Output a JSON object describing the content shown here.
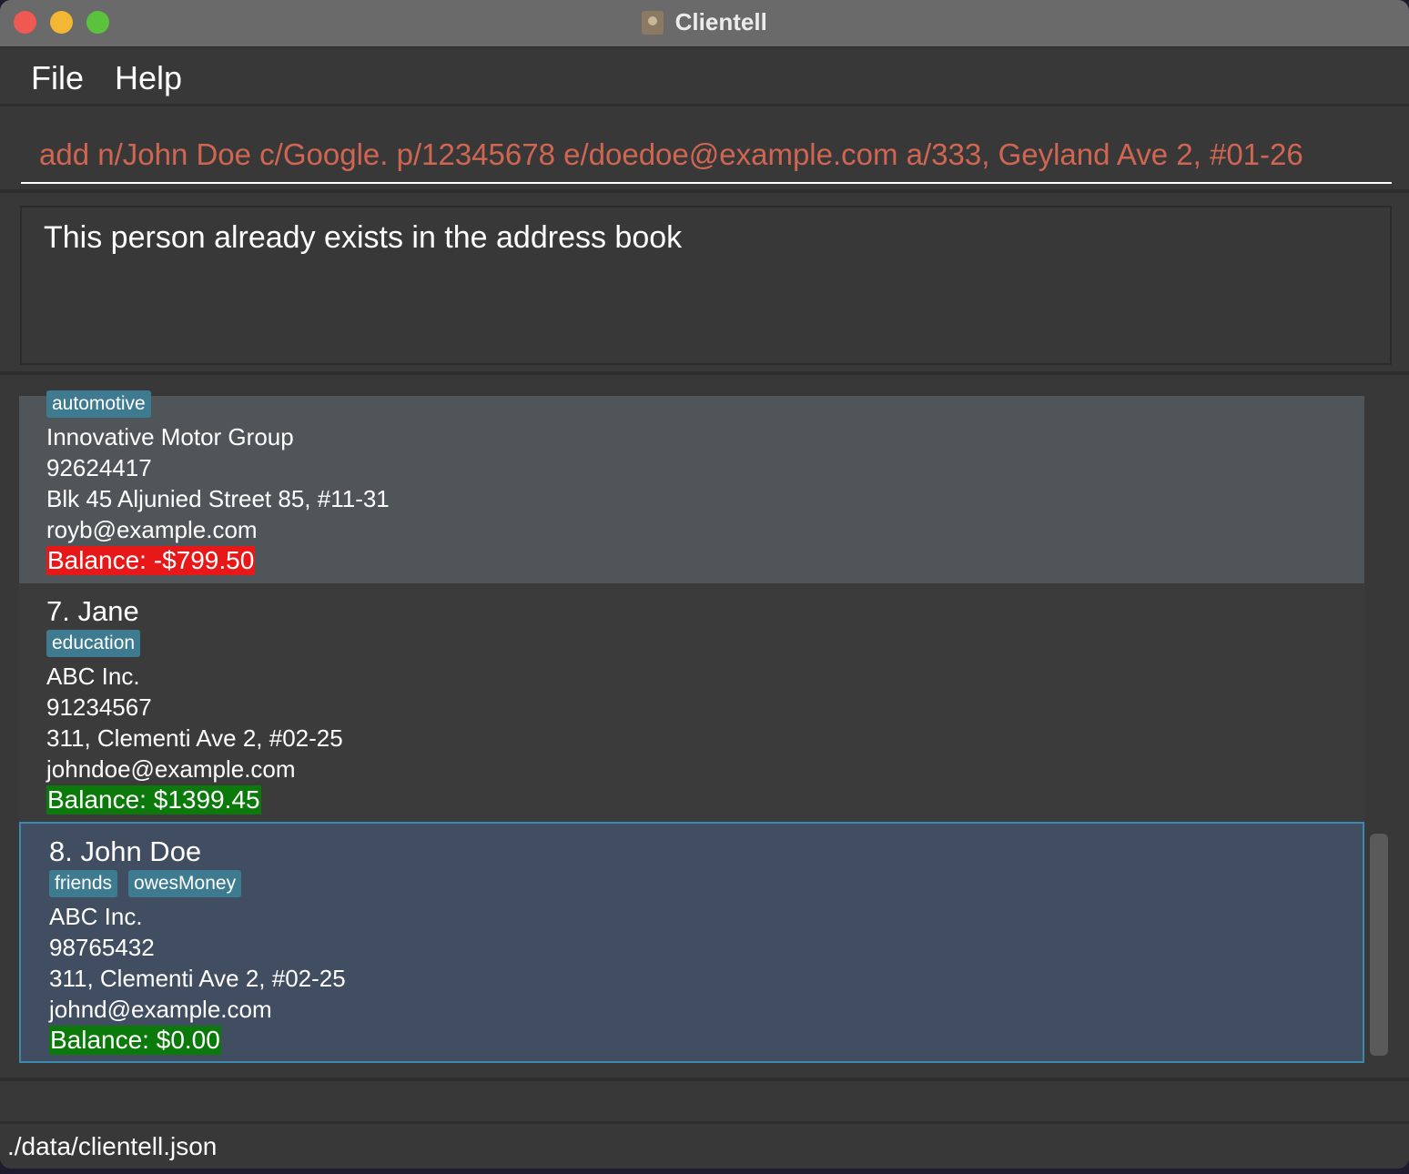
{
  "window": {
    "title": "Clientell"
  },
  "menu": {
    "file_label": "File",
    "help_label": "Help"
  },
  "command": {
    "value": "add n/John Doe c/Google. p/12345678 e/doedoe@example.com a/333, Geyland Ave 2, #01-26"
  },
  "result": {
    "message": "This person already exists in the address book"
  },
  "persons": [
    {
      "name": "",
      "tags": [
        "automotive"
      ],
      "company": "Innovative Motor Group",
      "phone": "92624417",
      "address": "Blk 45 Aljunied Street 85, #11-31",
      "email": "royb@example.com",
      "balance": "Balance: -$799.50",
      "balance_status": "negative"
    },
    {
      "name": "7. Jane",
      "tags": [
        "education"
      ],
      "company": "ABC Inc.",
      "phone": "91234567",
      "address": "311, Clementi Ave 2, #02-25",
      "email": "johndoe@example.com",
      "balance": "Balance: $1399.45",
      "balance_status": "positive"
    },
    {
      "name": "8. John Doe",
      "tags": [
        "friends",
        "owesMoney"
      ],
      "company": "ABC Inc.",
      "phone": "98765432",
      "address": "311, Clementi Ave 2, #02-25",
      "email": "johnd@example.com",
      "balance": "Balance: $0.00",
      "balance_status": "positive",
      "selected": true
    }
  ],
  "status": {
    "file_path": "./data/clientell.json"
  },
  "colors": {
    "window_bg": "#383838",
    "titlebar_bg": "#6b6a6b",
    "command_text": "#d06651",
    "tag_bg": "#3e7b91",
    "balance_negative": "#e81818",
    "balance_positive": "#0b7a0b",
    "selected_card_bg": "#414d61",
    "selected_card_border": "#3b88b0"
  }
}
